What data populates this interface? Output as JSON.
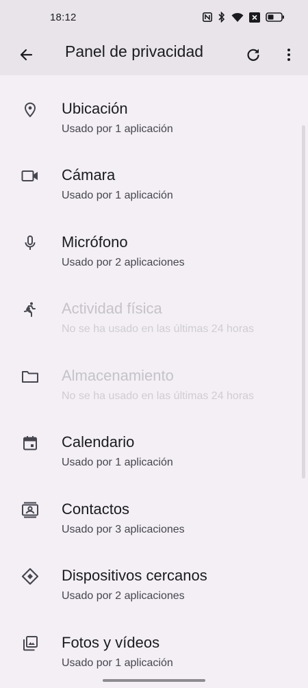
{
  "status": {
    "time": "18:12",
    "icons": [
      "nfc-icon",
      "bluetooth-icon",
      "wifi-icon",
      "sim-off-icon",
      "battery-icon"
    ]
  },
  "appbar": {
    "title": "Panel de privacidad",
    "back_icon": "arrow-back-icon",
    "refresh_icon": "refresh-icon",
    "more_icon": "more-vert-icon"
  },
  "items": [
    {
      "label": "Ubicación",
      "sub": "Usado por 1 aplicación",
      "icon": "location-icon",
      "enabled": true
    },
    {
      "label": "Cámara",
      "sub": "Usado por 1 aplicación",
      "icon": "camera-icon",
      "enabled": true
    },
    {
      "label": "Micrófono",
      "sub": "Usado por 2 aplicaciones",
      "icon": "microphone-icon",
      "enabled": true
    },
    {
      "label": "Actividad física",
      "sub": "No se ha usado en las últimas 24 horas",
      "icon": "running-icon",
      "enabled": false
    },
    {
      "label": "Almacenamiento",
      "sub": "No se ha usado en las últimas 24 horas",
      "icon": "folder-icon",
      "enabled": false
    },
    {
      "label": "Calendario",
      "sub": "Usado por 1 aplicación",
      "icon": "calendar-icon",
      "enabled": true
    },
    {
      "label": "Contactos",
      "sub": "Usado por 3 aplicaciones",
      "icon": "contacts-icon",
      "enabled": true
    },
    {
      "label": "Dispositivos cercanos",
      "sub": "Usado por 2 aplicaciones",
      "icon": "nearby-devices-icon",
      "enabled": true
    },
    {
      "label": "Fotos y vídeos",
      "sub": "Usado por 1 aplicación",
      "icon": "photos-icon",
      "enabled": true
    }
  ],
  "colors": {
    "background": "#f3eff4",
    "app_bar": "#e8e4e9",
    "text_primary": "#1b1b1f",
    "text_secondary": "#46464f",
    "text_disabled": "#c5c2ca"
  }
}
